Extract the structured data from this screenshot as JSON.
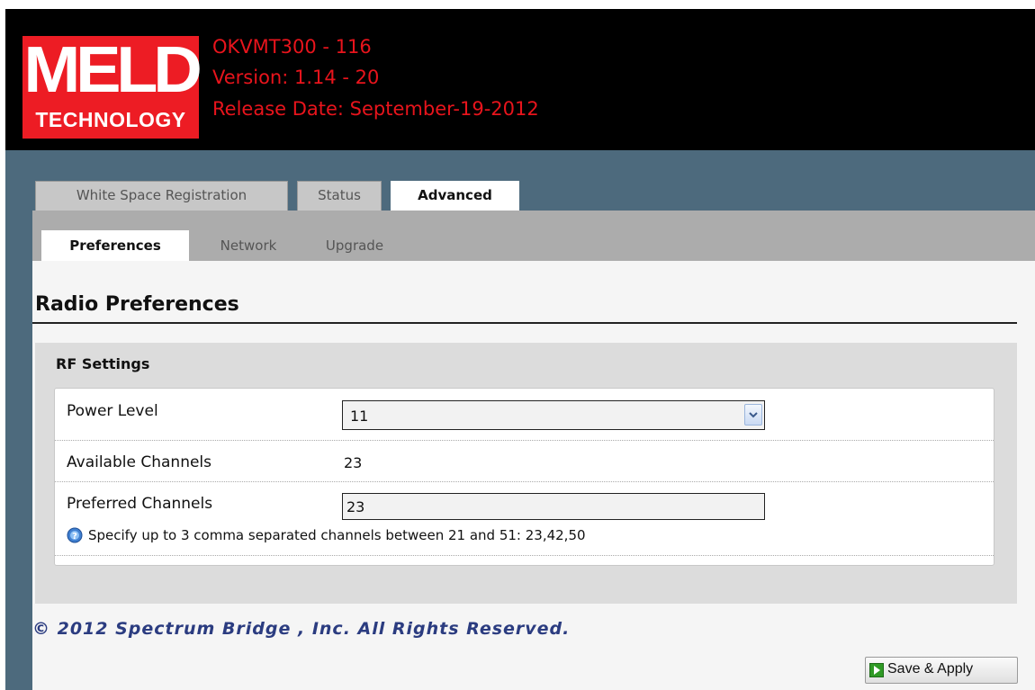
{
  "header": {
    "logo": {
      "line1": "MELD",
      "line2": "TECHNOLOGY",
      "color": "#ed1c24"
    },
    "device": "OKVMT300 - 116",
    "version": "Version: 1.14 - 20",
    "release_date": "Release Date: September-19-2012",
    "text_color": "#e8141c"
  },
  "tabs": [
    {
      "label": "White Space Registration",
      "active": false
    },
    {
      "label": "Status",
      "active": false
    },
    {
      "label": "Advanced",
      "active": true
    }
  ],
  "subtabs": [
    {
      "label": "Preferences",
      "active": true
    },
    {
      "label": "Network",
      "active": false
    },
    {
      "label": "Upgrade",
      "active": false
    }
  ],
  "page_title": "Radio Preferences",
  "rf_settings": {
    "legend": "RF Settings",
    "power_level": {
      "label": "Power Level",
      "value": "11"
    },
    "available_channels": {
      "label": "Available Channels",
      "value": "23"
    },
    "preferred_channels": {
      "label": "Preferred Channels",
      "value": "23",
      "help": "Specify up to 3 comma separated channels between 21 and 51: 23,42,50",
      "help_icon": "help-icon"
    }
  },
  "copyright": "© 2012 Spectrum Bridge , Inc. All Rights Reserved.",
  "save_button": {
    "label": "Save & Apply",
    "icon": "save-icon"
  }
}
